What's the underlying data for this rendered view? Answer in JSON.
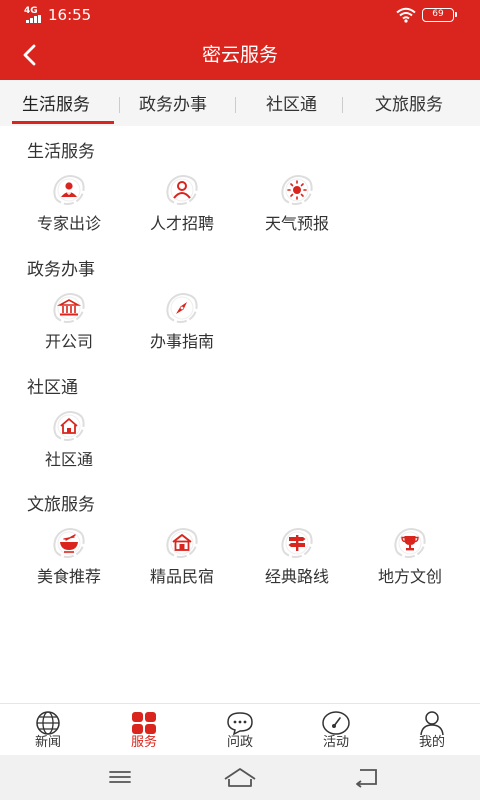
{
  "status": {
    "network": "4G",
    "time": "16:55",
    "battery": "69"
  },
  "header": {
    "title": "密云服务"
  },
  "tabs": [
    {
      "label": "生活服务",
      "active": true
    },
    {
      "label": "政务办事",
      "active": false
    },
    {
      "label": "社区通",
      "active": false
    },
    {
      "label": "文旅服务",
      "active": false
    }
  ],
  "sections": [
    {
      "title": "生活服务",
      "items": [
        {
          "label": "专家出诊",
          "icon": "doctor-icon"
        },
        {
          "label": "人才招聘",
          "icon": "person-icon"
        },
        {
          "label": "天气预报",
          "icon": "sun-icon"
        }
      ]
    },
    {
      "title": "政务办事",
      "items": [
        {
          "label": "开公司",
          "icon": "building-icon"
        },
        {
          "label": "办事指南",
          "icon": "compass-icon"
        }
      ]
    },
    {
      "title": "社区通",
      "items": [
        {
          "label": "社区通",
          "icon": "house-icon"
        }
      ]
    },
    {
      "title": "文旅服务",
      "items": [
        {
          "label": "美食推荐",
          "icon": "food-icon"
        },
        {
          "label": "精品民宿",
          "icon": "homestay-icon"
        },
        {
          "label": "经典路线",
          "icon": "signpost-icon"
        },
        {
          "label": "地方文创",
          "icon": "trophy-icon"
        }
      ]
    }
  ],
  "bottom_nav": [
    {
      "label": "新闻",
      "icon": "globe-icon",
      "active": false
    },
    {
      "label": "服务",
      "icon": "grid-icon",
      "active": true
    },
    {
      "label": "问政",
      "icon": "chat-icon",
      "active": false
    },
    {
      "label": "活动",
      "icon": "gauge-icon",
      "active": false
    },
    {
      "label": "我的",
      "icon": "user-icon",
      "active": false
    }
  ],
  "colors": {
    "brand_red": "#d9251d",
    "icon_ring": "#dddddd",
    "text": "#333333"
  }
}
